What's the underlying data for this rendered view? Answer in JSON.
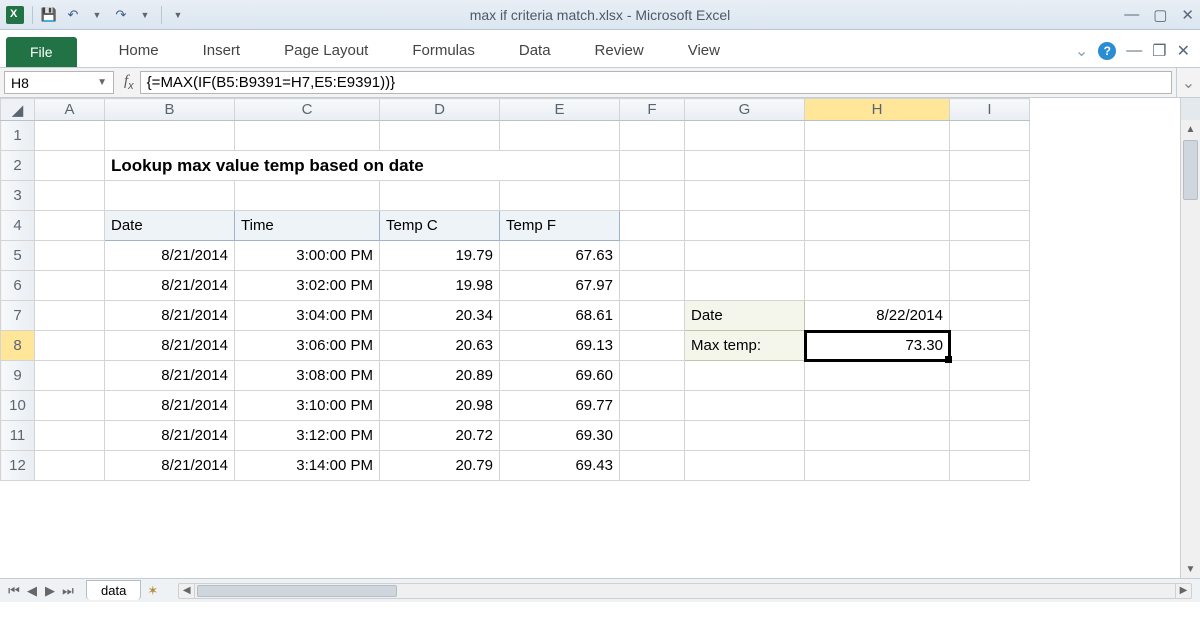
{
  "window": {
    "title": "max if criteria match.xlsx - Microsoft Excel"
  },
  "qat": {
    "save": "💾",
    "undo": "↶",
    "redo": "↷"
  },
  "ribbon": {
    "file": "File",
    "tabs": [
      "Home",
      "Insert",
      "Page Layout",
      "Formulas",
      "Data",
      "Review",
      "View"
    ]
  },
  "namebox": "H8",
  "formula": "{=MAX(IF(B5:B9391=H7,E5:E9391))}",
  "columns": [
    "A",
    "B",
    "C",
    "D",
    "E",
    "F",
    "G",
    "H",
    "I"
  ],
  "rows": [
    "1",
    "2",
    "3",
    "4",
    "5",
    "6",
    "7",
    "8",
    "9",
    "10",
    "11",
    "12"
  ],
  "active": {
    "row": "8",
    "col": "H"
  },
  "title_cell": "Lookup max value temp based on date",
  "table": {
    "headers": [
      "Date",
      "Time",
      "Temp C",
      "Temp F"
    ],
    "rows": [
      [
        "8/21/2014",
        "3:00:00 PM",
        "19.79",
        "67.63"
      ],
      [
        "8/21/2014",
        "3:02:00 PM",
        "19.98",
        "67.97"
      ],
      [
        "8/21/2014",
        "3:04:00 PM",
        "20.34",
        "68.61"
      ],
      [
        "8/21/2014",
        "3:06:00 PM",
        "20.63",
        "69.13"
      ],
      [
        "8/21/2014",
        "3:08:00 PM",
        "20.89",
        "69.60"
      ],
      [
        "8/21/2014",
        "3:10:00 PM",
        "20.98",
        "69.77"
      ],
      [
        "8/21/2014",
        "3:12:00 PM",
        "20.72",
        "69.30"
      ],
      [
        "8/21/2014",
        "3:14:00 PM",
        "20.79",
        "69.43"
      ]
    ]
  },
  "lookup": {
    "date_label": "Date",
    "date_value": "8/22/2014",
    "max_label": "Max temp:",
    "max_value": "73.30"
  },
  "sheet": {
    "name": "data"
  }
}
